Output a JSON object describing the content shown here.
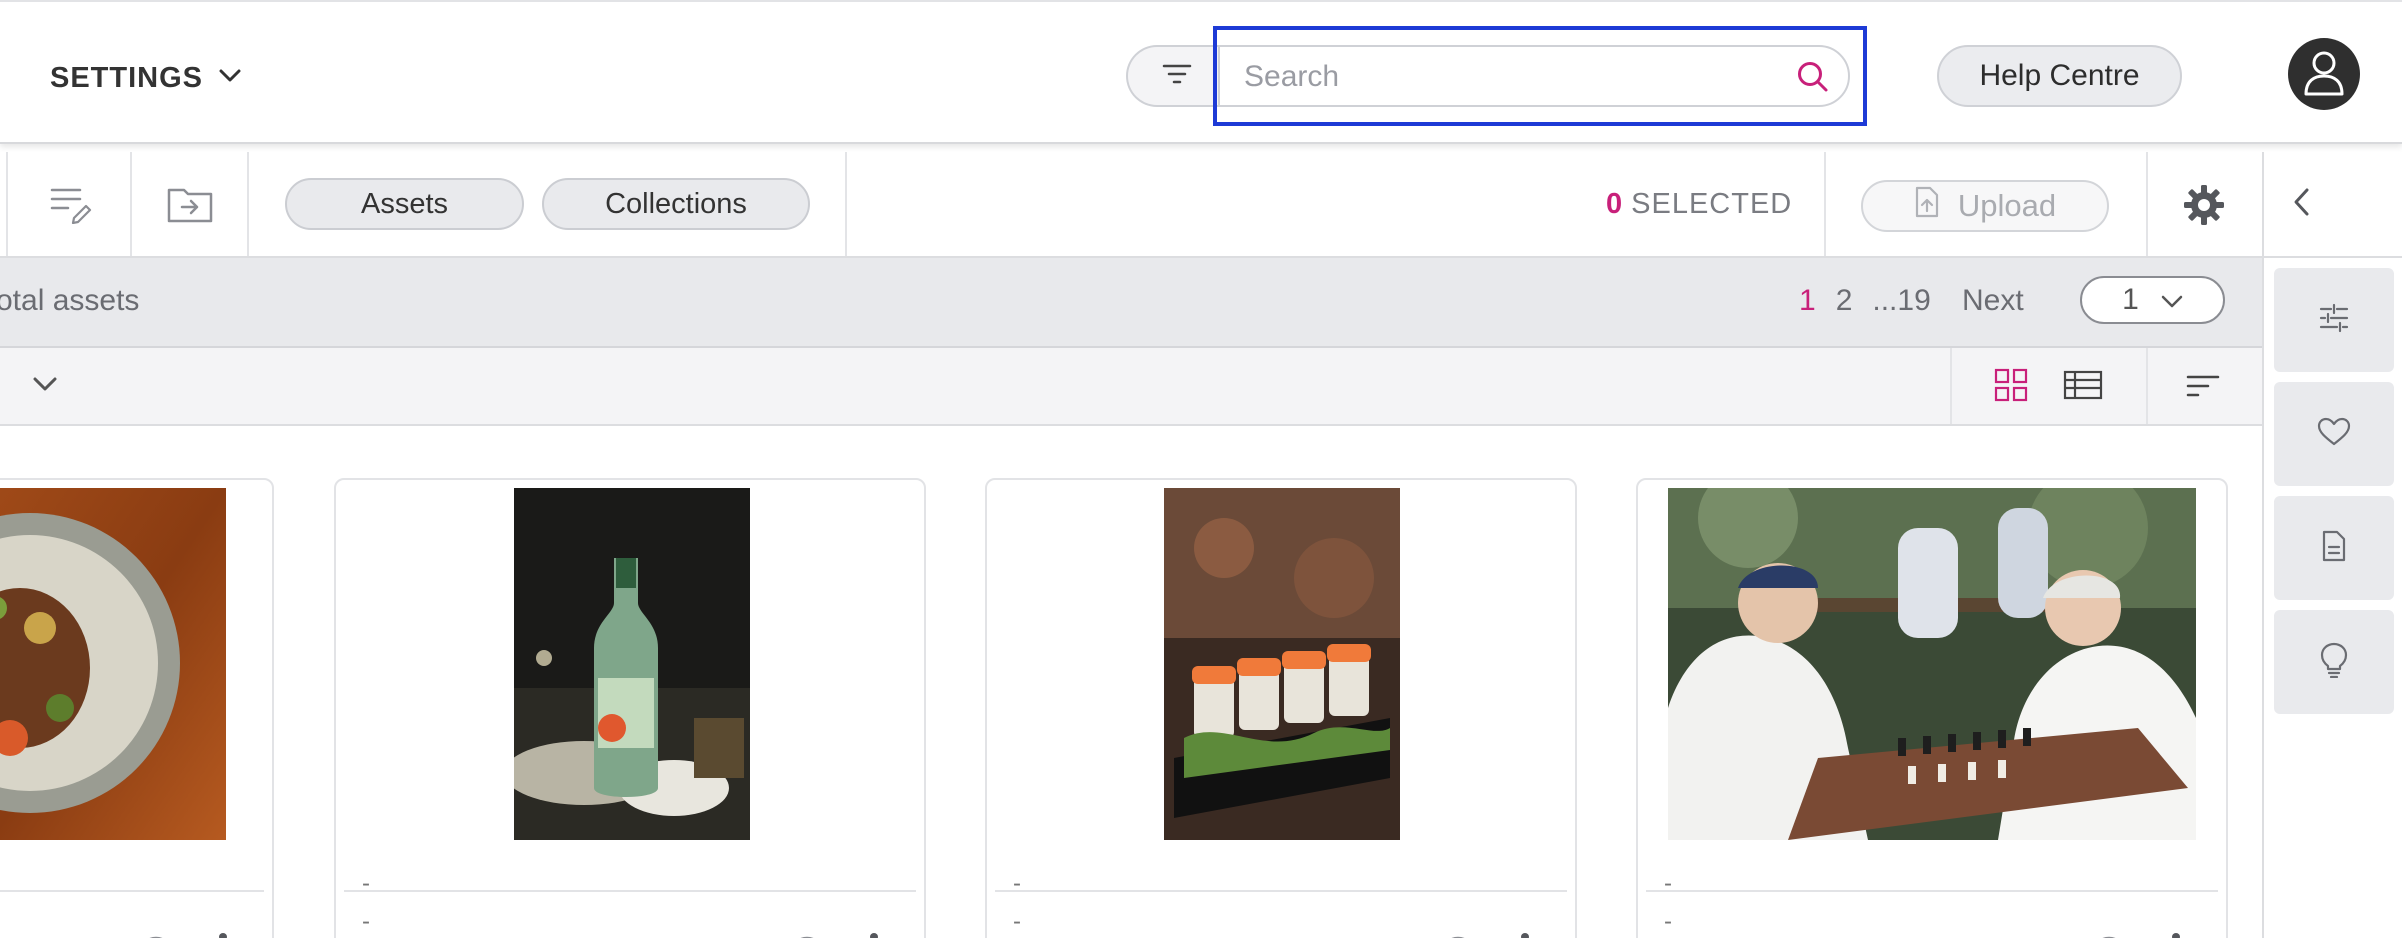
{
  "header": {
    "settings_label": "SETTINGS",
    "search_placeholder": "Search",
    "search_value": "",
    "help_label": "Help Centre"
  },
  "toolbar": {
    "tabs": [
      {
        "label": "Assets"
      },
      {
        "label": "Collections"
      }
    ],
    "selected_count": "0",
    "selected_label": "SELECTED",
    "upload_label": "Upload"
  },
  "info": {
    "total_text": "otal assets",
    "pages": [
      "1",
      "2",
      "...19"
    ],
    "next_label": "Next",
    "page_select": "1"
  },
  "cards": [
    {
      "meta1": "",
      "meta2": ""
    },
    {
      "meta1": "-",
      "meta2": "-"
    },
    {
      "meta1": "-",
      "meta2": "-"
    },
    {
      "meta1": "-",
      "meta2": "-"
    }
  ],
  "colors": {
    "accent": "#c8207a",
    "focus_outline": "#1d3ad6",
    "avatar_bg": "#2f2f2f"
  },
  "icons": {
    "settings_chevron": "chevron-down-icon",
    "filter": "filter-icon",
    "search": "search-icon",
    "avatar": "user-icon",
    "edit_list": "edit-list-icon",
    "move_to_folder": "folder-move-icon",
    "upload": "upload-file-icon",
    "settings": "gear-icon",
    "collapse": "chevron-left-icon",
    "grid_view": "grid-view-icon",
    "list_view": "list-view-icon",
    "sort": "sort-icon",
    "rail": [
      "sliders-icon",
      "heart-icon",
      "document-icon",
      "lightbulb-icon"
    ],
    "card_visibility": "visibility-off-icon",
    "card_menu": "more-vertical-icon"
  }
}
